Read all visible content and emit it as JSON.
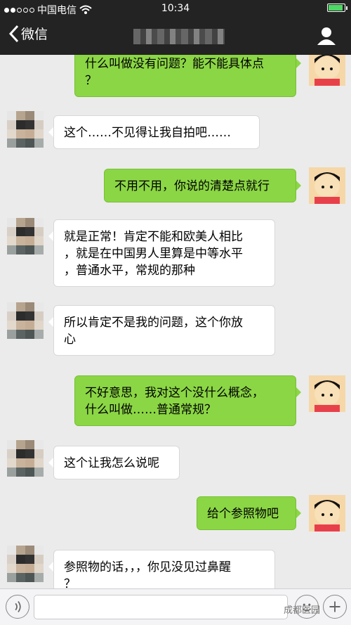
{
  "status_bar": {
    "carrier": "中国电信",
    "time": "10:34"
  },
  "nav": {
    "back_label": "微信",
    "title": ""
  },
  "messages": [
    {
      "side": "right",
      "text": "什么叫做没有问题？能不能具体点\n？"
    },
    {
      "side": "left",
      "text": "这个……不见得让我自拍吧……"
    },
    {
      "side": "right",
      "text": "不用不用，你说的清楚点就行"
    },
    {
      "side": "left",
      "text": "就是正常！肯定不能和欧美人相比\n，就是在中国男人里算是中等水平\n，普通水平，常规的那种"
    },
    {
      "side": "left",
      "text": "所以肯定不是我的问题，这个你放\n心"
    },
    {
      "side": "right",
      "text": "不好意思，我对这个没什么概念，\n什么叫做……普通常规？"
    },
    {
      "side": "left",
      "text": "这个让我怎么说呢"
    },
    {
      "side": "right",
      "text": "给个参照物吧"
    },
    {
      "side": "left",
      "text": "参照物的话，，，你见没见过鼻醒\n？"
    }
  ],
  "input": {
    "value": "",
    "placeholder": ""
  },
  "watermark": "成都医园",
  "colors": {
    "my_bubble": "#8bd645",
    "friend_bubble": "#ffffff",
    "background": "#ebebeb",
    "topbar": "#232323"
  },
  "icons": {
    "back": "chevron-left-icon",
    "profile": "person-icon",
    "voice": "voice-icon",
    "emoji": "emoji-icon",
    "plus": "plus-icon"
  }
}
